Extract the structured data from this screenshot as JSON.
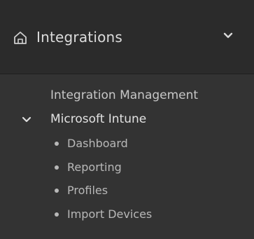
{
  "nav": {
    "section_title": "Integrations",
    "section_icon": "home-icon",
    "collapse_icon": "chevron-down-icon"
  },
  "menu": {
    "top_link": "Integration Management",
    "group": {
      "label": "Microsoft Intune",
      "icon": "chevron-down-icon",
      "items": [
        {
          "label": "Dashboard"
        },
        {
          "label": "Reporting"
        },
        {
          "label": "Profiles"
        },
        {
          "label": "Import Devices"
        }
      ]
    }
  }
}
